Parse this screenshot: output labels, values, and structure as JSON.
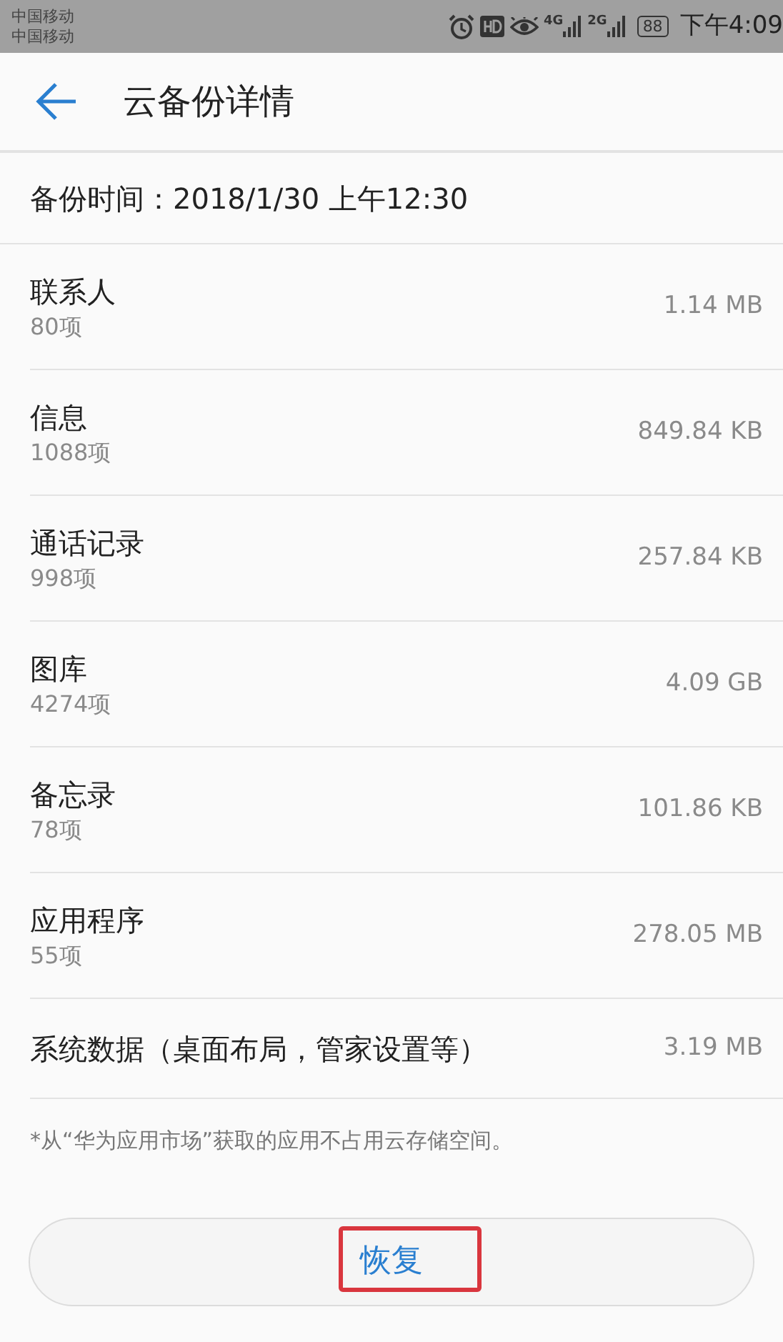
{
  "status_bar": {
    "carriers": [
      "中国移动",
      "中国移动"
    ],
    "network_1": "4G",
    "network_2": "2G",
    "battery": "88",
    "time": "下午4:09"
  },
  "header": {
    "title": "云备份详情"
  },
  "backup_time": "备份时间：2018/1/30 上午12:30",
  "items": [
    {
      "kind": "two-line",
      "name": "联系人",
      "count": "80项",
      "size": "1.14 MB"
    },
    {
      "kind": "two-line",
      "name": "信息",
      "count": "1088项",
      "size": "849.84 KB"
    },
    {
      "kind": "two-line",
      "name": "通话记录",
      "count": "998项",
      "size": "257.84 KB"
    },
    {
      "kind": "two-line",
      "name": "图库",
      "count": "4274项",
      "size": "4.09 GB"
    },
    {
      "kind": "two-line",
      "name": "备忘录",
      "count": "78项",
      "size": "101.86 KB"
    },
    {
      "kind": "two-line",
      "name": "应用程序",
      "count": "55项",
      "size": "278.05 MB"
    },
    {
      "kind": "one-line",
      "name": "系统数据（桌面布局，管家设置等）",
      "size": "3.19 MB"
    }
  ],
  "note": "*从“华为应用市场”获取的应用不占用云存储空间。",
  "restore_button": {
    "label": "恢复",
    "highlighted": true
  }
}
